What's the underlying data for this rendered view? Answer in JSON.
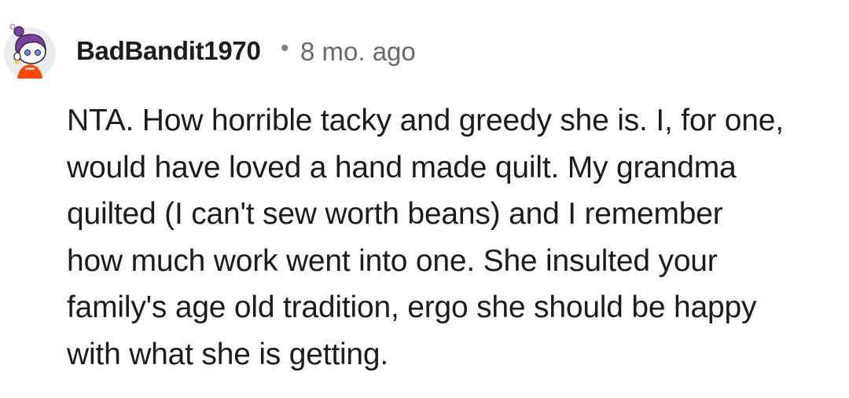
{
  "comment": {
    "author": "BadBandit1970",
    "separator": "•",
    "timestamp": "8 mo. ago",
    "body_lines": [
      "NTA. How horrible tacky and greedy she is. I, for one,",
      "would have loved a hand made quilt. My grandma",
      "quilted (I can't sew worth beans) and I remember",
      "how much work went into one. She insulted your",
      "family's age old tradition, ergo she should be happy",
      "with what she is getting."
    ],
    "avatar_icon": "snoo-avatar-icon"
  },
  "colors": {
    "text": "#1c1c1c",
    "meta": "#666a6e",
    "avatar_hair": "#7b3fa0",
    "avatar_shirt": "#ff4500",
    "avatar_bg": "#e9ecee"
  }
}
